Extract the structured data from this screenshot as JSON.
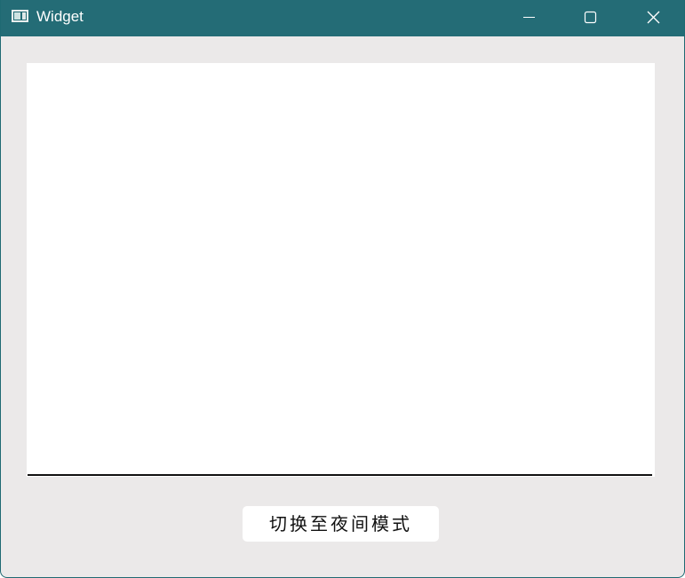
{
  "window": {
    "title": "Widget",
    "icon": "app-window-icon",
    "controls": {
      "minimize_icon": "minimize-icon",
      "maximize_icon": "maximize-icon",
      "close_icon": "close-icon"
    },
    "colors": {
      "titlebar": "#246c76",
      "body": "#ebe9e9",
      "canvas": "#ffffff"
    }
  },
  "main": {
    "toggle_button_label": "切换至夜间模式"
  }
}
